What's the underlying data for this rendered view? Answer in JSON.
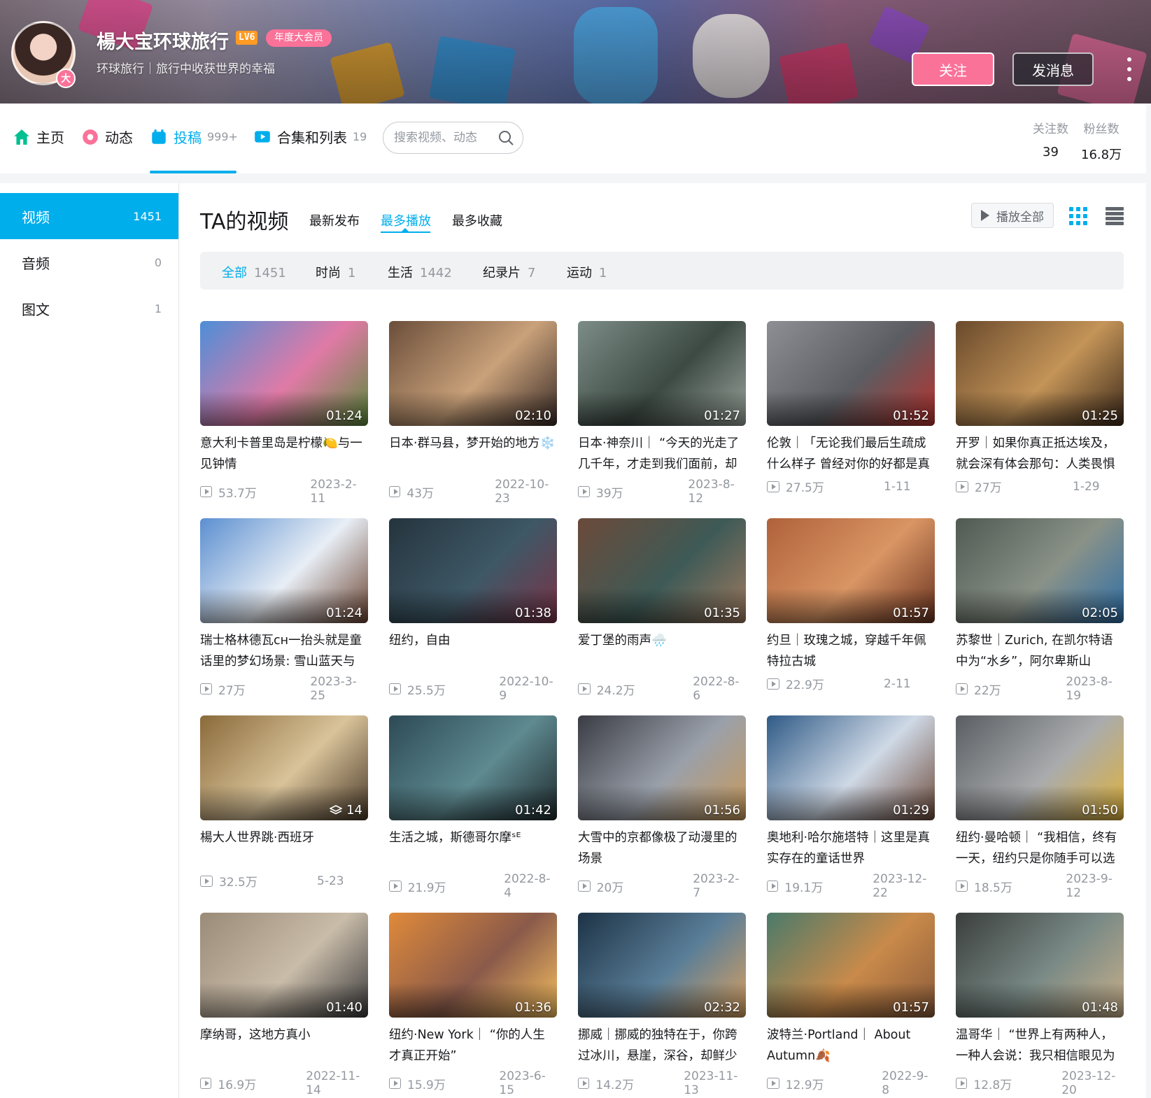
{
  "banner": {
    "username": "楊大宝环球旅行",
    "level": "LV6",
    "vip_label": "年度大会员",
    "avatar_badge": "大",
    "sign": "环球旅行｜旅行中收获世界的幸福",
    "follow_label": "关注",
    "message_label": "发消息"
  },
  "nav": {
    "home": "主页",
    "dynamic": "动态",
    "upload": "投稿",
    "upload_count": "999+",
    "collections": "合集和列表",
    "collections_count": "19",
    "search_placeholder": "搜索视频、动态",
    "following_label": "关注数",
    "following_value": "39",
    "fans_label": "粉丝数",
    "fans_value": "16.8万"
  },
  "sidebar": {
    "items": [
      {
        "label": "视频",
        "count": "1451"
      },
      {
        "label": "音频",
        "count": "0"
      },
      {
        "label": "图文",
        "count": "1"
      }
    ]
  },
  "main": {
    "title": "TA的视频",
    "sort_tabs": [
      "最新发布",
      "最多播放",
      "最多收藏"
    ],
    "play_all": "播放全部",
    "filters": [
      {
        "label": "全部",
        "count": "1451"
      },
      {
        "label": "时尚",
        "count": "1"
      },
      {
        "label": "生活",
        "count": "1442"
      },
      {
        "label": "纪录片",
        "count": "7"
      },
      {
        "label": "运动",
        "count": "1"
      }
    ]
  },
  "videos": [
    {
      "title": "意大利卡普里岛是柠檬🍋与一见钟情",
      "duration": "01:24",
      "views": "53.7万",
      "date": "2023-2-11",
      "colors": [
        "#4d8ed8",
        "#e07aa6",
        "#5a8a3a"
      ]
    },
    {
      "title": "日本·群马县，梦开始的地方❄️",
      "duration": "02:10",
      "views": "43万",
      "date": "2022-10-23",
      "colors": [
        "#6b4e3a",
        "#c9a17a",
        "#3a2c28"
      ]
    },
    {
      "title": "日本·神奈川｜ “今天的光走了几千年，才走到我们面前，却",
      "duration": "01:27",
      "views": "39万",
      "date": "2023-8-12",
      "colors": [
        "#7c8c86",
        "#3d4a44",
        "#9aa59c"
      ]
    },
    {
      "title": "伦敦｜「无论我们最后生疏成什么样子 曾经对你的好都是真",
      "duration": "01:52",
      "views": "27.5万",
      "date": "1-11",
      "colors": [
        "#8d8f94",
        "#5b5d62",
        "#b9332f"
      ]
    },
    {
      "title": "开罗｜如果你真正抵达埃及，就会深有体会那句：人类畏惧",
      "duration": "01:25",
      "views": "27万",
      "date": "1-29",
      "colors": [
        "#6a4a2c",
        "#c49458",
        "#3c2a1b"
      ]
    },
    {
      "title": "瑞士格林德瓦ᴄʜ一抬头就是童话里的梦幻场景: 雪山蓝天与",
      "duration": "01:24",
      "views": "27万",
      "date": "2023-3-25",
      "colors": [
        "#5b8fd0",
        "#e8eef5",
        "#6b4432"
      ]
    },
    {
      "title": "纽约，自由",
      "duration": "01:38",
      "views": "25.5万",
      "date": "2022-10-9",
      "colors": [
        "#25343e",
        "#3e5866",
        "#7a3348"
      ]
    },
    {
      "title": "爱丁堡的雨声🌧️",
      "duration": "01:35",
      "views": "24.2万",
      "date": "2022-8-6",
      "colors": [
        "#6b4a3a",
        "#3e5a56",
        "#a07a60"
      ]
    },
    {
      "title": "约旦｜玫瑰之城，穿越千年佩特拉古城",
      "duration": "01:57",
      "views": "22.9万",
      "date": "2-11",
      "colors": [
        "#b0623a",
        "#d99564",
        "#6a3320"
      ]
    },
    {
      "title": "苏黎世｜Zurich, 在凯尔特语中为“水乡”，阿尔卑斯山",
      "duration": "02:05",
      "views": "22万",
      "date": "2023-8-19",
      "colors": [
        "#4f5a52",
        "#8a9288",
        "#2e6fa8"
      ]
    },
    {
      "title": "楊大人世界跳·西班牙",
      "duration": "14",
      "views": "32.5万",
      "date": "5-23",
      "colors": [
        "#8a6a3a",
        "#d9c39a",
        "#4a3a2a"
      ]
    },
    {
      "title": "生活之城，斯德哥尔摩ˢᴱ",
      "duration": "01:42",
      "views": "21.9万",
      "date": "2022-8-4",
      "colors": [
        "#2d4a56",
        "#5e8a90",
        "#1f2a2e"
      ]
    },
    {
      "title": "大雪中的京都像极了动漫里的场景",
      "duration": "01:56",
      "views": "20万",
      "date": "2023-2-7",
      "colors": [
        "#3a3c44",
        "#9aa0aa",
        "#c99a5a"
      ]
    },
    {
      "title": "奥地利·哈尔施塔特｜这里是真实存在的童话世界",
      "duration": "01:29",
      "views": "19.1万",
      "date": "2023-12-22",
      "colors": [
        "#2f5a86",
        "#cfd9e6",
        "#6d4a3a"
      ]
    },
    {
      "title": "纽约·曼哈顿｜ “我相信，终有一天，纽约只是你随手可以选",
      "duration": "01:50",
      "views": "18.5万",
      "date": "2023-9-12",
      "colors": [
        "#5a5e62",
        "#a9abad",
        "#e0b23a"
      ]
    },
    {
      "title": "摩纳哥，这地方真小",
      "duration": "01:40",
      "views": "16.9万",
      "date": "2022-11-14",
      "colors": [
        "#9a8a78",
        "#c9bca9",
        "#3a3a3c"
      ]
    },
    {
      "title": "纽约·New York｜ “你的人生才真正开始”",
      "duration": "01:36",
      "views": "15.9万",
      "date": "2023-6-15",
      "colors": [
        "#e08a3a",
        "#8a5a4a",
        "#f6c060"
      ]
    },
    {
      "title": "挪威｜挪威的独特在于，你跨过冰川，悬崖，深谷，却鲜少",
      "duration": "02:32",
      "views": "14.2万",
      "date": "2023-11-13",
      "colors": [
        "#1d3346",
        "#5a7e98",
        "#d9a060"
      ]
    },
    {
      "title": "波特兰·Portland｜ About Autumn🍂",
      "duration": "01:57",
      "views": "12.9万",
      "date": "2022-9-8",
      "colors": [
        "#4a7a6a",
        "#c98a4a",
        "#8a5a3a"
      ]
    },
    {
      "title": "温哥华｜ “世界上有两种人，一种人会说：我只相信眼见为",
      "duration": "01:48",
      "views": "12.8万",
      "date": "2023-12-20",
      "colors": [
        "#3a3e3c",
        "#7a8a86",
        "#c9b08a"
      ]
    }
  ]
}
